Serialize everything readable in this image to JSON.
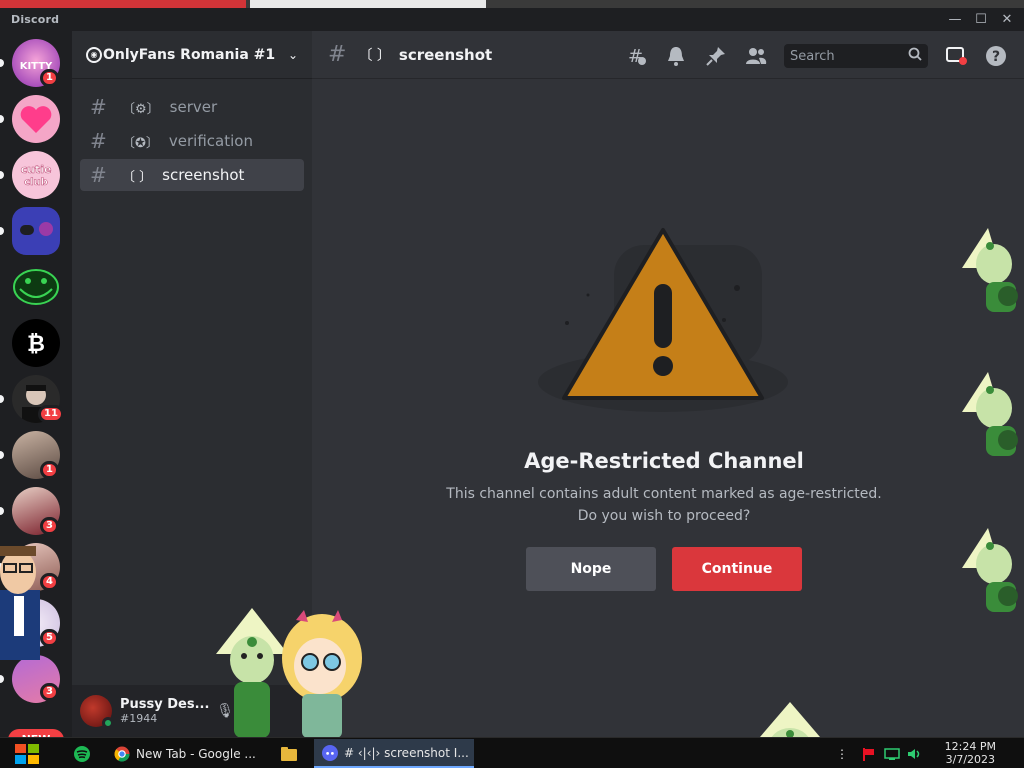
{
  "window": {
    "app_name": "Discord",
    "controls": {
      "minimize": "—",
      "maximize": "☐",
      "close": "✕"
    }
  },
  "server_rail": {
    "servers": [
      {
        "name": "kitty-server",
        "badge": "1",
        "unread": true
      },
      {
        "name": "heart-server",
        "badge": "",
        "unread": true
      },
      {
        "name": "cutie-club",
        "badge": "",
        "unread": true
      },
      {
        "name": "purple-server",
        "badge": "",
        "unread": true
      },
      {
        "name": "trollface-server",
        "badge": "",
        "unread": false
      },
      {
        "name": "bitcoin-server",
        "badge": "",
        "unread": false
      },
      {
        "name": "dark-avatar-server",
        "badge": "11",
        "unread": true
      },
      {
        "name": "photo-server-1",
        "badge": "1",
        "unread": true
      },
      {
        "name": "photo-server-2",
        "badge": "3",
        "unread": true
      },
      {
        "name": "photo-server-3",
        "badge": "4",
        "unread": true
      },
      {
        "name": "photo-server-4",
        "badge": "5",
        "unread": true
      },
      {
        "name": "photo-server-5",
        "badge": "3",
        "unread": true
      }
    ],
    "new_label": "NEW"
  },
  "sidebar": {
    "guild_name": "OnlyFans Romania #1",
    "channels": [
      {
        "name": "server",
        "icon": "〔⚙〕",
        "active": false
      },
      {
        "name": "verification",
        "icon": "〔✪〕",
        "active": false
      },
      {
        "name": "screenshot",
        "icon": "〔 〕",
        "active": true
      }
    ]
  },
  "user": {
    "name": "Pussy Des...",
    "tag": "#1944"
  },
  "header": {
    "channel_icon": "〔 〕",
    "channel_name": "screenshot",
    "search_placeholder": "Search"
  },
  "gate": {
    "title": "Age-Restricted Channel",
    "line1": "This channel contains adult content marked as age-restricted.",
    "line2": "Do you wish to proceed?",
    "nope_label": "Nope",
    "continue_label": "Continue"
  },
  "taskbar": {
    "items": [
      {
        "label": "New Tab - Google ...",
        "icon": "chrome-icon"
      },
      {
        "label": "# ‹|‹|› screenshot I...",
        "icon": "discord-icon"
      }
    ],
    "time": "12:24 PM",
    "date": "3/7/2023"
  },
  "colors": {
    "accent_red": "#da373c",
    "warning_fill": "#c57f18",
    "online": "#23a55a"
  }
}
